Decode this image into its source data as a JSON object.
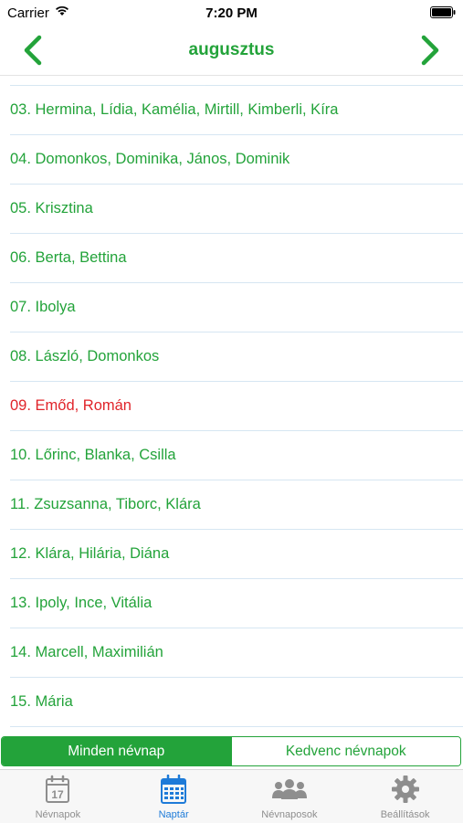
{
  "status_bar": {
    "carrier": "Carrier",
    "time": "7:20 PM"
  },
  "nav": {
    "title": "augusztus"
  },
  "list": {
    "rows": [
      {
        "text": "03. Hermina, Lídia, Kamélia, Mirtill, Kimberli, Kíra",
        "today": false
      },
      {
        "text": "04. Domonkos, Dominika, János, Dominik",
        "today": false
      },
      {
        "text": "05. Krisztina",
        "today": false
      },
      {
        "text": "06. Berta, Bettina",
        "today": false
      },
      {
        "text": "07. Ibolya",
        "today": false
      },
      {
        "text": "08. László, Domonkos",
        "today": false
      },
      {
        "text": "09. Emőd, Román",
        "today": true
      },
      {
        "text": "10. Lőrinc, Blanka, Csilla",
        "today": false
      },
      {
        "text": "11. Zsuzsanna, Tiborc, Klára",
        "today": false
      },
      {
        "text": "12. Klára, Hilária, Diána",
        "today": false
      },
      {
        "text": "13. Ipoly, Ince, Vitália",
        "today": false
      },
      {
        "text": "14. Marcell, Maximilián",
        "today": false
      },
      {
        "text": "15. Mária",
        "today": false
      }
    ]
  },
  "segment": {
    "all_label": "Minden névnap",
    "fav_label": "Kedvenc névnapok"
  },
  "tabs": [
    {
      "label": "Névnapok",
      "icon": "calendar-day-icon",
      "day": "17"
    },
    {
      "label": "Naptár",
      "icon": "calendar-grid-icon"
    },
    {
      "label": "Névnaposok",
      "icon": "people-icon"
    },
    {
      "label": "Beállítások",
      "icon": "gear-icon"
    }
  ],
  "colors": {
    "accent": "#23a33a",
    "today": "#e0242a",
    "tab_active": "#1e7bd8",
    "tab_inactive": "#8e8e8e"
  }
}
